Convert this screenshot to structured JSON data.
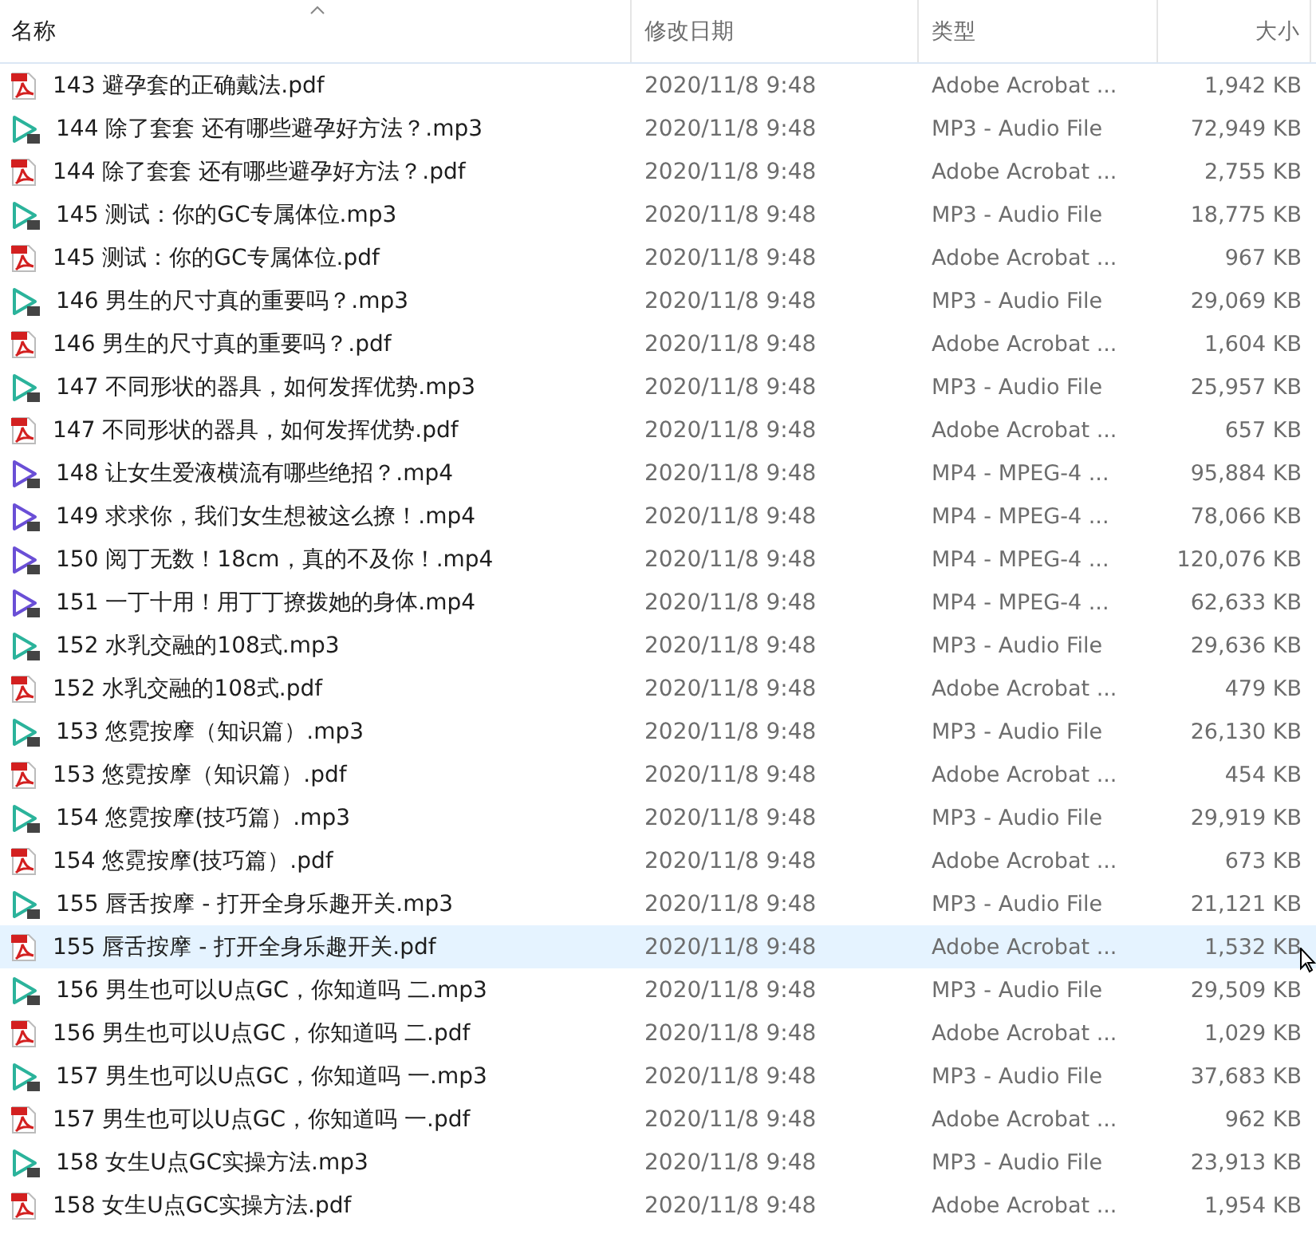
{
  "columns": [
    {
      "label": "名称",
      "sorted": true
    },
    {
      "label": "修改日期",
      "sorted": false
    },
    {
      "label": "类型",
      "sorted": false
    },
    {
      "label": "大小",
      "sorted": false
    }
  ],
  "files": [
    {
      "kind": "pdf",
      "name": "143 避孕套的正确戴法.pdf",
      "date": "2020/11/8 9:48",
      "type": "Adobe Acrobat ...",
      "size": "1,942 KB",
      "hovered": false
    },
    {
      "kind": "mp3",
      "name": "144 除了套套 还有哪些避孕好方法？.mp3",
      "date": "2020/11/8 9:48",
      "type": "MP3 - Audio File",
      "size": "72,949 KB",
      "hovered": false
    },
    {
      "kind": "pdf",
      "name": "144 除了套套 还有哪些避孕好方法？.pdf",
      "date": "2020/11/8 9:48",
      "type": "Adobe Acrobat ...",
      "size": "2,755 KB",
      "hovered": false
    },
    {
      "kind": "mp3",
      "name": "145 测试：你的GC专属体位.mp3",
      "date": "2020/11/8 9:48",
      "type": "MP3 - Audio File",
      "size": "18,775 KB",
      "hovered": false
    },
    {
      "kind": "pdf",
      "name": "145 测试：你的GC专属体位.pdf",
      "date": "2020/11/8 9:48",
      "type": "Adobe Acrobat ...",
      "size": "967 KB",
      "hovered": false
    },
    {
      "kind": "mp3",
      "name": "146 男生的尺寸真的重要吗？.mp3",
      "date": "2020/11/8 9:48",
      "type": "MP3 - Audio File",
      "size": "29,069 KB",
      "hovered": false
    },
    {
      "kind": "pdf",
      "name": "146 男生的尺寸真的重要吗？.pdf",
      "date": "2020/11/8 9:48",
      "type": "Adobe Acrobat ...",
      "size": "1,604 KB",
      "hovered": false
    },
    {
      "kind": "mp3",
      "name": "147 不同形状的器具，如何发挥优势.mp3",
      "date": "2020/11/8 9:48",
      "type": "MP3 - Audio File",
      "size": "25,957 KB",
      "hovered": false
    },
    {
      "kind": "pdf",
      "name": "147 不同形状的器具，如何发挥优势.pdf",
      "date": "2020/11/8 9:48",
      "type": "Adobe Acrobat ...",
      "size": "657 KB",
      "hovered": false
    },
    {
      "kind": "mp4",
      "name": "148 让女生爱液横流有哪些绝招？.mp4",
      "date": "2020/11/8 9:48",
      "type": "MP4 - MPEG-4 ...",
      "size": "95,884 KB",
      "hovered": false
    },
    {
      "kind": "mp4",
      "name": "149 求求你，我们女生想被这么撩！.mp4",
      "date": "2020/11/8 9:48",
      "type": "MP4 - MPEG-4 ...",
      "size": "78,066 KB",
      "hovered": false
    },
    {
      "kind": "mp4",
      "name": "150 阅丁无数！18cm，真的不及你！.mp4",
      "date": "2020/11/8 9:48",
      "type": "MP4 - MPEG-4 ...",
      "size": "120,076 KB",
      "hovered": false
    },
    {
      "kind": "mp4",
      "name": "151 一丁十用！用丁丁撩拨她的身体.mp4",
      "date": "2020/11/8 9:48",
      "type": "MP4 - MPEG-4 ...",
      "size": "62,633 KB",
      "hovered": false
    },
    {
      "kind": "mp3",
      "name": "152 水乳交融的108式.mp3",
      "date": "2020/11/8 9:48",
      "type": "MP3 - Audio File",
      "size": "29,636 KB",
      "hovered": false
    },
    {
      "kind": "pdf",
      "name": "152 水乳交融的108式.pdf",
      "date": "2020/11/8 9:48",
      "type": "Adobe Acrobat ...",
      "size": "479 KB",
      "hovered": false
    },
    {
      "kind": "mp3",
      "name": "153 悠霓按摩（知识篇）.mp3",
      "date": "2020/11/8 9:48",
      "type": "MP3 - Audio File",
      "size": "26,130 KB",
      "hovered": false
    },
    {
      "kind": "pdf",
      "name": "153 悠霓按摩（知识篇）.pdf",
      "date": "2020/11/8 9:48",
      "type": "Adobe Acrobat ...",
      "size": "454 KB",
      "hovered": false
    },
    {
      "kind": "mp3",
      "name": "154 悠霓按摩(技巧篇）.mp3",
      "date": "2020/11/8 9:48",
      "type": "MP3 - Audio File",
      "size": "29,919 KB",
      "hovered": false
    },
    {
      "kind": "pdf",
      "name": "154 悠霓按摩(技巧篇）.pdf",
      "date": "2020/11/8 9:48",
      "type": "Adobe Acrobat ...",
      "size": "673 KB",
      "hovered": false
    },
    {
      "kind": "mp3",
      "name": "155 唇舌按摩 - 打开全身乐趣开关.mp3",
      "date": "2020/11/8 9:48",
      "type": "MP3 - Audio File",
      "size": "21,121 KB",
      "hovered": false
    },
    {
      "kind": "pdf",
      "name": "155 唇舌按摩 - 打开全身乐趣开关.pdf",
      "date": "2020/11/8 9:48",
      "type": "Adobe Acrobat ...",
      "size": "1,532 KB",
      "hovered": true
    },
    {
      "kind": "mp3",
      "name": "156 男生也可以U点GC，你知道吗 二.mp3",
      "date": "2020/11/8 9:48",
      "type": "MP3 - Audio File",
      "size": "29,509 KB",
      "hovered": false
    },
    {
      "kind": "pdf",
      "name": "156 男生也可以U点GC，你知道吗 二.pdf",
      "date": "2020/11/8 9:48",
      "type": "Adobe Acrobat ...",
      "size": "1,029 KB",
      "hovered": false
    },
    {
      "kind": "mp3",
      "name": "157 男生也可以U点GC，你知道吗 一.mp3",
      "date": "2020/11/8 9:48",
      "type": "MP3 - Audio File",
      "size": "37,683 KB",
      "hovered": false
    },
    {
      "kind": "pdf",
      "name": "157 男生也可以U点GC，你知道吗 一.pdf",
      "date": "2020/11/8 9:48",
      "type": "Adobe Acrobat ...",
      "size": "962 KB",
      "hovered": false
    },
    {
      "kind": "mp3",
      "name": "158 女生U点GC实操方法.mp3",
      "date": "2020/11/8 9:48",
      "type": "MP3 - Audio File",
      "size": "23,913 KB",
      "hovered": false
    },
    {
      "kind": "pdf",
      "name": "158 女生U点GC实操方法.pdf",
      "date": "2020/11/8 9:48",
      "type": "Adobe Acrobat ...",
      "size": "1,954 KB",
      "hovered": false
    }
  ]
}
